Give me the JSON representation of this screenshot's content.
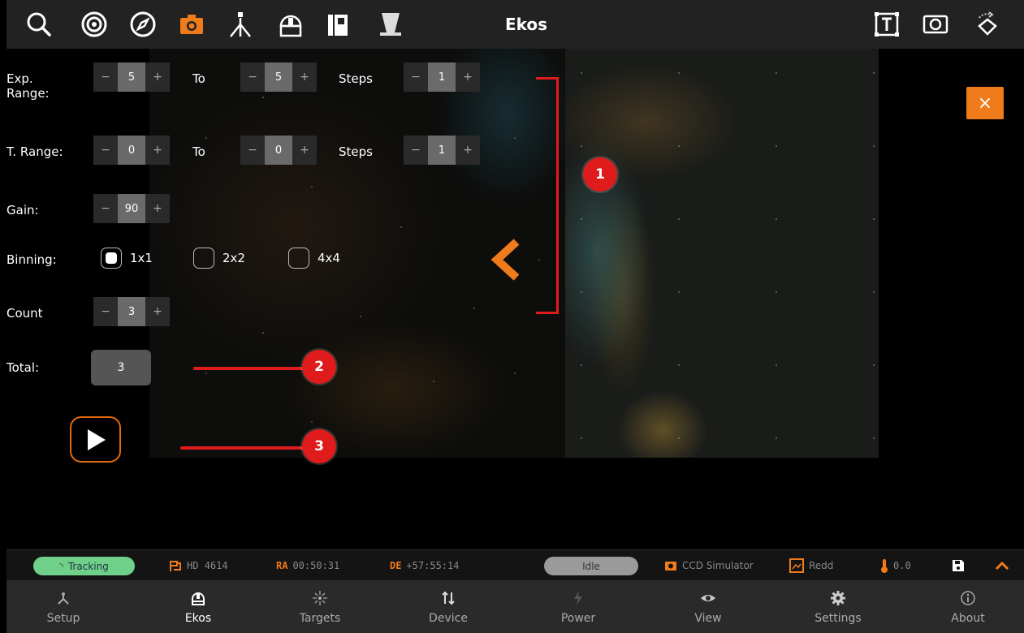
{
  "header": {
    "title": "Ekos"
  },
  "toolbar_icons": [
    "search-icon",
    "target-icon",
    "compass-icon",
    "camera-icon",
    "telescope-icon",
    "dome-icon",
    "filter-icon",
    "focuser-icon",
    "text-box-icon",
    "frame-icon",
    "rotate-icon"
  ],
  "controls": {
    "exp_range": {
      "label": "Exp.\nRange:",
      "from": "5",
      "to_label": "To",
      "to": "5",
      "steps_label": "Steps",
      "steps": "1"
    },
    "t_range": {
      "label": "T. Range:",
      "from": "0",
      "to_label": "To",
      "to": "0",
      "steps_label": "Steps",
      "steps": "1"
    },
    "gain": {
      "label": "Gain:",
      "value": "90"
    },
    "binning": {
      "label": "Binning:",
      "options": [
        "1x1",
        "2x2",
        "4x4"
      ],
      "selected": "1x1"
    },
    "count": {
      "label": "Count",
      "value": "3"
    },
    "total": {
      "label": "Total:",
      "value": "3"
    },
    "minus": "−",
    "plus": "+"
  },
  "close_label": "×",
  "annotations": {
    "one": "1",
    "two": "2",
    "three": "3"
  },
  "status": {
    "tracking": "Tracking",
    "target": "HD 4614",
    "ra_label": "RA",
    "ra": "00:50:31",
    "de_label": "DE",
    "de": "+57:55:14",
    "state": "Idle",
    "camera": "CCD Simulator",
    "filter": "Redd",
    "temp": "0.0"
  },
  "nav": [
    {
      "label": "Setup"
    },
    {
      "label": "Ekos"
    },
    {
      "label": "Targets"
    },
    {
      "label": "Device"
    },
    {
      "label": "Power"
    },
    {
      "label": "View"
    },
    {
      "label": "Settings"
    },
    {
      "label": "About"
    }
  ],
  "colors": {
    "accent": "#ef7b1a",
    "annotation": "#e01b1b",
    "tracking": "#6fd08a"
  }
}
